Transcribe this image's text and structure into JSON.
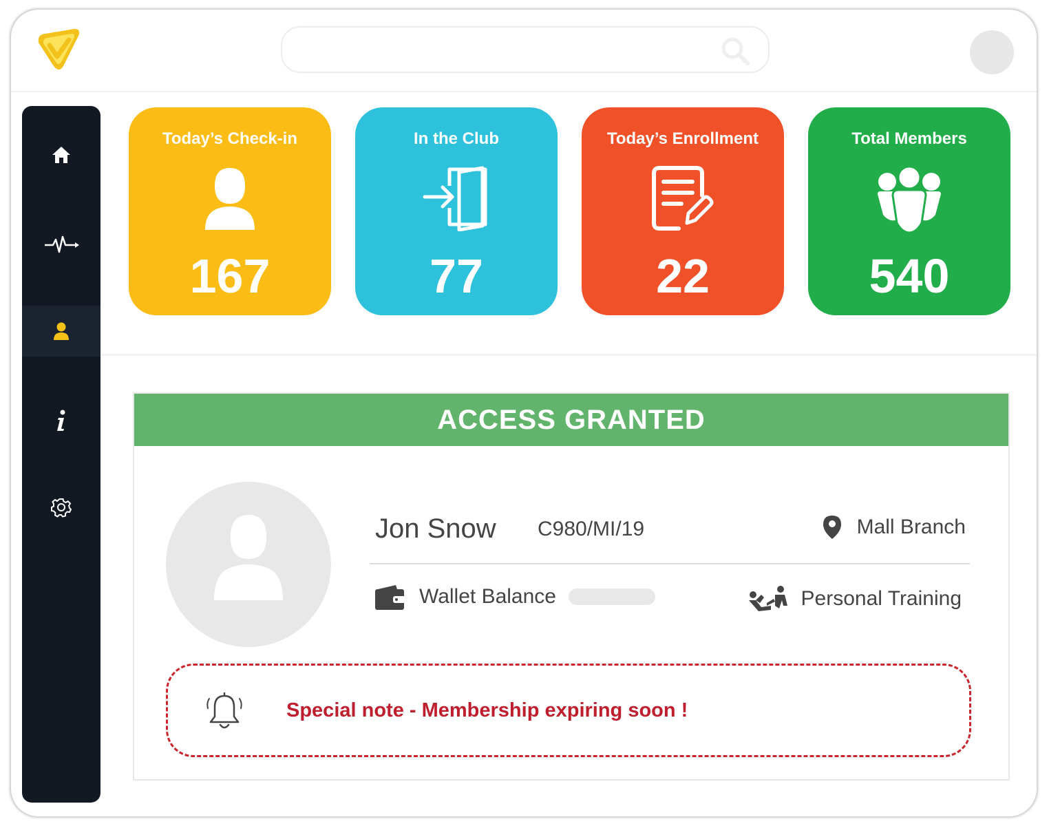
{
  "search": {
    "placeholder": ""
  },
  "sidebar": {
    "items": [
      {
        "name": "home",
        "icon": "home-icon"
      },
      {
        "name": "activity",
        "icon": "pulse-icon"
      },
      {
        "name": "members",
        "icon": "user-icon",
        "active": true
      },
      {
        "name": "info",
        "icon": "info-icon"
      },
      {
        "name": "settings",
        "icon": "gear-icon"
      }
    ]
  },
  "stats": [
    {
      "title": "Today’s Check-in",
      "value": "167",
      "color": "#fbbc15",
      "icon": "user-icon"
    },
    {
      "title": "In the Club",
      "value": "77",
      "color": "#2dc1dc",
      "icon": "door-enter-icon"
    },
    {
      "title": "Today’s Enrollment",
      "value": "22",
      "color": "#f05129",
      "icon": "form-edit-icon"
    },
    {
      "title": "Total Members",
      "value": "540",
      "color": "#22ad4b",
      "icon": "group-icon"
    }
  ],
  "access": {
    "banner": "ACCESS GRANTED",
    "banner_color": "#62b36b",
    "member": {
      "name": "Jon Snow",
      "id": "C980/MI/19",
      "branch": "Mall Branch",
      "wallet_label": "Wallet Balance",
      "plan": "Personal Training"
    },
    "note": "Special note - Membership expiring soon !",
    "note_color": "#be1e2d"
  }
}
